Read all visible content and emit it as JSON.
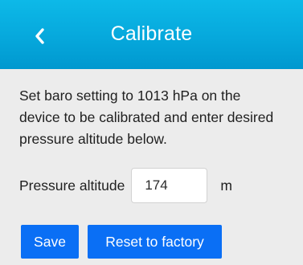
{
  "header": {
    "title": "Calibrate",
    "back_icon": "chevron-left-icon"
  },
  "instructions": "Set baro setting to 1013 hPa on the device to be calibrated and enter desired pressure altitude below.",
  "pressure_altitude": {
    "label": "Pressure altitude",
    "value": "174",
    "unit": "m"
  },
  "actions": {
    "save_label": "Save",
    "reset_label": "Reset to factory"
  },
  "colors": {
    "header_background": "#06a8dc",
    "button_background": "#0a6ff5",
    "page_background": "#ececec"
  }
}
